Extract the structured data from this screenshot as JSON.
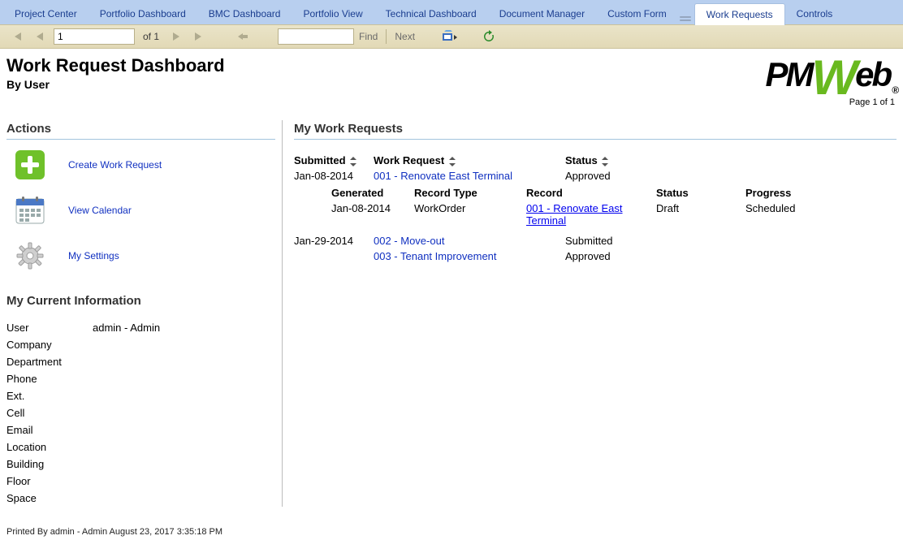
{
  "tabs": [
    {
      "label": "Project Center",
      "active": false
    },
    {
      "label": "Portfolio Dashboard",
      "active": false
    },
    {
      "label": "BMC Dashboard",
      "active": false
    },
    {
      "label": "Portfolio View",
      "active": false
    },
    {
      "label": "Technical Dashboard",
      "active": false
    },
    {
      "label": "Document Manager",
      "active": false
    },
    {
      "label": "Custom Form",
      "active": false
    },
    {
      "label": "Work Requests",
      "active": true
    },
    {
      "label": "Controls",
      "active": false
    }
  ],
  "toolbar": {
    "page_value": "1",
    "page_total": "of  1",
    "search_value": "",
    "find_label": "Find",
    "next_label": "Next"
  },
  "header": {
    "title": "Work Request Dashboard",
    "subtitle": "By User",
    "brand_left": "PM",
    "brand_w": "W",
    "brand_right": "eb",
    "registered": "®",
    "pageof": "Page 1 of 1"
  },
  "actions_header": "Actions",
  "actions": [
    {
      "label": "Create Work Request",
      "key": "create"
    },
    {
      "label": "View Calendar",
      "key": "calendar"
    },
    {
      "label": "My Settings",
      "key": "settings"
    }
  ],
  "info_header": "My Current Information",
  "info_rows": [
    {
      "label": "User",
      "value": "admin - Admin"
    },
    {
      "label": "Company",
      "value": ""
    },
    {
      "label": "Department",
      "value": ""
    },
    {
      "label": "Phone",
      "value": ""
    },
    {
      "label": "Ext.",
      "value": ""
    },
    {
      "label": "Cell",
      "value": ""
    },
    {
      "label": "Email",
      "value": ""
    },
    {
      "label": "Location",
      "value": ""
    },
    {
      "label": "Building",
      "value": ""
    },
    {
      "label": "Floor",
      "value": ""
    },
    {
      "label": "Space",
      "value": ""
    }
  ],
  "requests_header": "My Work Requests",
  "grid_headers": {
    "submitted": "Submitted",
    "work_request": "Work Request",
    "status": "Status"
  },
  "sub_headers": {
    "generated": "Generated",
    "record_type": "Record Type",
    "record": "Record",
    "status": "Status",
    "progress": "Progress"
  },
  "chart_data": {
    "type": "table",
    "requests": [
      {
        "submitted": "Jan-08-2014",
        "work_request": "001 - Renovate East Terminal",
        "status": "Approved",
        "children": [
          {
            "generated": "Jan-08-2014",
            "record_type": "WorkOrder",
            "record": "001 - Renovate East Terminal",
            "status": "Draft",
            "progress": "Scheduled"
          }
        ]
      },
      {
        "submitted": "Jan-29-2014",
        "work_request": "002 - Move-out",
        "status": "Submitted",
        "children": []
      },
      {
        "submitted": "",
        "work_request": "003 - Tenant Improvement",
        "status": "Approved",
        "children": []
      }
    ]
  },
  "footer_text": "Printed By admin - Admin  August 23, 2017 3:35:18 PM"
}
